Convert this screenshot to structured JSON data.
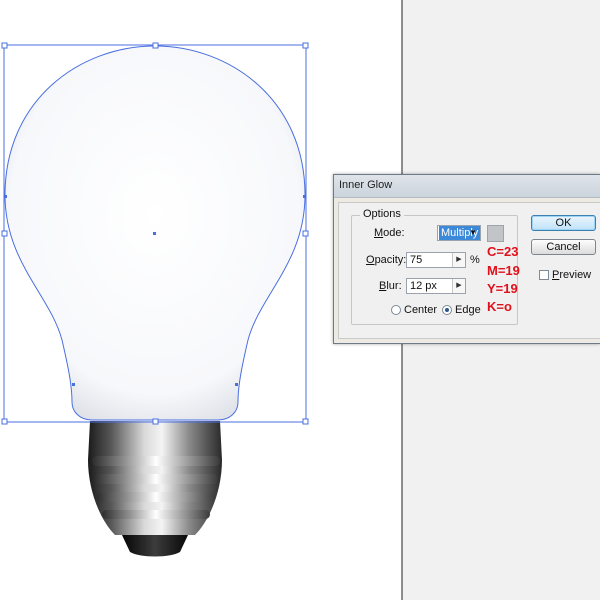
{
  "dialog": {
    "title": "Inner Glow",
    "options_group": "Options",
    "mode": {
      "label_prefix": "",
      "label_mnemonic": "M",
      "label_rest": "ode:",
      "value": "Multiply"
    },
    "opacity": {
      "label_mnemonic": "O",
      "label_rest": "pacity:",
      "value": "75",
      "unit": "%"
    },
    "blur": {
      "label_mnemonic": "B",
      "label_rest": "lur:",
      "value": "12 px"
    },
    "center_label": "Center",
    "edge_label": "Edge",
    "ok_label": "OK",
    "cancel_label": "Cancel",
    "preview_label": "Preview",
    "selected_source": "edge",
    "preview_checked": false
  },
  "annotation": {
    "c": "C=23",
    "m": "M=19",
    "y": "Y=19",
    "k": "K=o"
  },
  "colors": {
    "selection": "#4a6fe0",
    "annotation": "#e0101a",
    "glow_swatch": "#c2c4c8"
  }
}
